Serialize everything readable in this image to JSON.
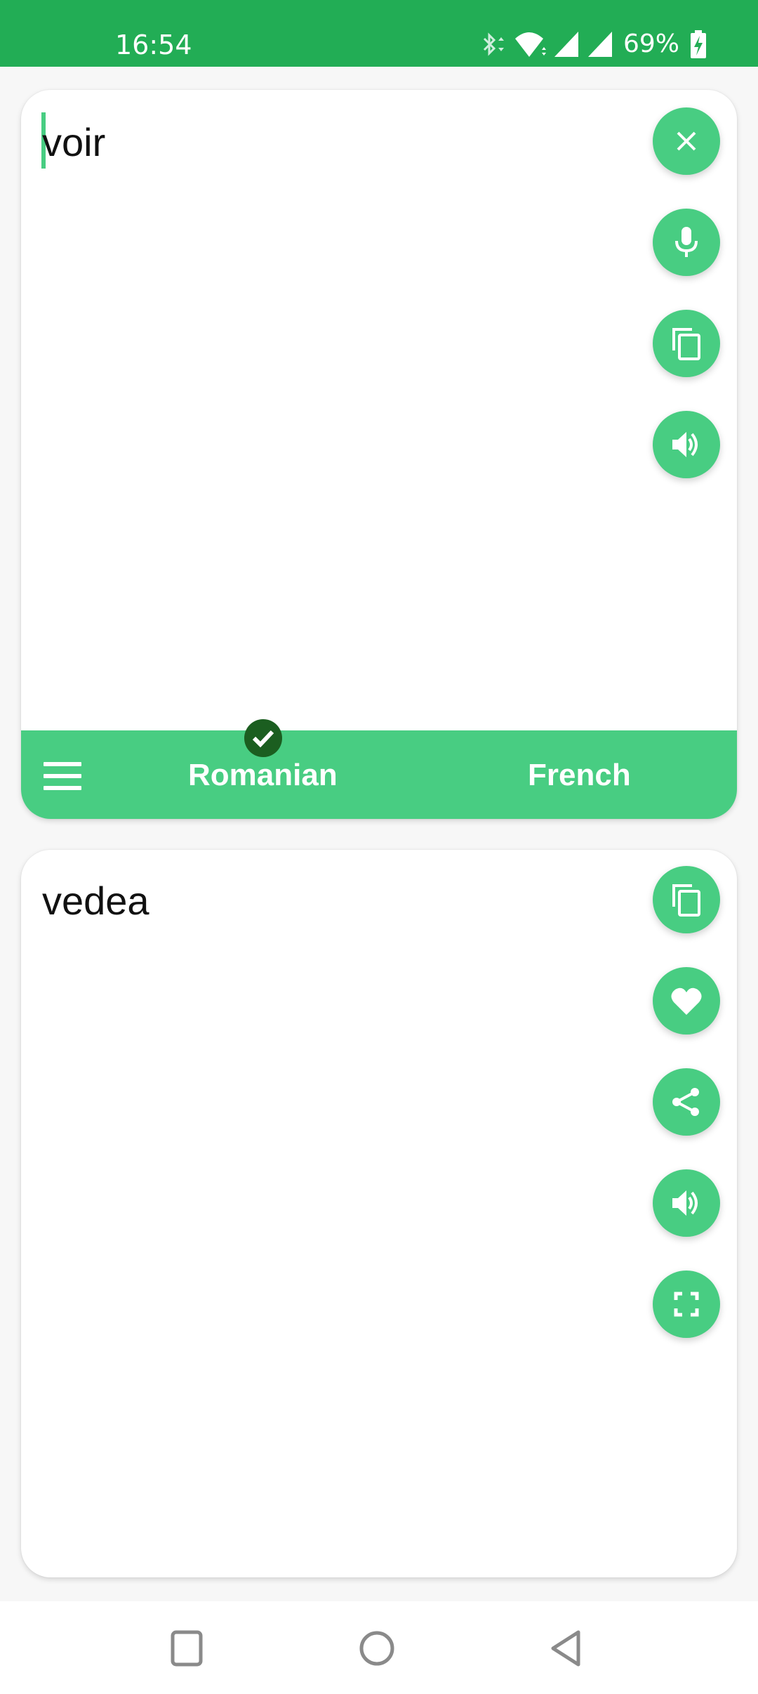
{
  "status_bar": {
    "time": "16:54",
    "battery_percent": "69%",
    "icons": [
      "bluetooth-icon",
      "wifi-icon",
      "signal-icon",
      "signal-icon",
      "battery-charging-icon"
    ]
  },
  "source_panel": {
    "text": "voir",
    "buttons": [
      {
        "name": "clear-button",
        "icon": "close-icon"
      },
      {
        "name": "voice-input-button",
        "icon": "microphone-icon"
      },
      {
        "name": "copy-source-button",
        "icon": "copy-icon"
      },
      {
        "name": "speak-source-button",
        "icon": "speaker-icon"
      }
    ]
  },
  "language_bar": {
    "menu_icon": "hamburger-menu-icon",
    "source_language": "Romanian",
    "target_language": "French",
    "selected_indicator": "check-icon"
  },
  "target_panel": {
    "text": "vedea",
    "buttons": [
      {
        "name": "copy-translation-button",
        "icon": "copy-icon"
      },
      {
        "name": "favorite-button",
        "icon": "heart-icon"
      },
      {
        "name": "share-button",
        "icon": "share-icon"
      },
      {
        "name": "speak-translation-button",
        "icon": "speaker-icon"
      },
      {
        "name": "fullscreen-button",
        "icon": "fullscreen-icon"
      }
    ]
  },
  "nav_bar": {
    "buttons": [
      "recents-button",
      "home-button",
      "back-button"
    ]
  },
  "colors": {
    "status_bar": "#22ad55",
    "accent": "#48cd82",
    "check_badge": "#1b5e20",
    "background": "#f7f7f7"
  }
}
